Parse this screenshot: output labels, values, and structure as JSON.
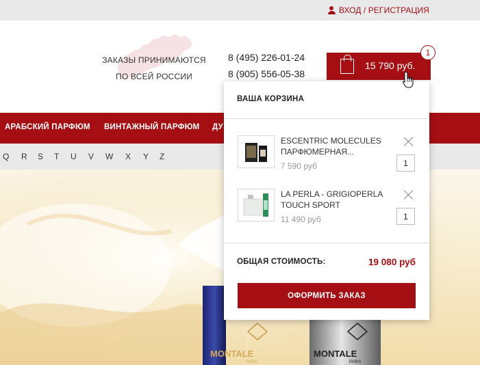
{
  "topbar": {
    "login_label": "ВХОД / РЕГИСТРАЦИЯ"
  },
  "header": {
    "orders_line1": "ЗАКАЗЫ ПРИНИМАЮТСЯ",
    "orders_line2": "ПО ВСЕЙ РОССИИ",
    "phone1": "8 (495) 226-01-24",
    "phone2": "8 (905) 556-05-38"
  },
  "cart": {
    "total": "15 790 руб.",
    "count": "1"
  },
  "nav": {
    "items": [
      "АРАБСКИЙ ПАРФЮМ",
      "ВИНТАЖНЫЙ ПАРФЮМ",
      "ДУ"
    ]
  },
  "alphabet": [
    "Q",
    "R",
    "S",
    "T",
    "U",
    "V",
    "W",
    "X",
    "Y",
    "Z"
  ],
  "dropdown": {
    "title": "ВАША КОРЗИНА",
    "items": [
      {
        "name": "ESCENTRIC MOLECULES ПАРФЮМЕРНАЯ...",
        "price": "7 590 руб",
        "qty": "1"
      },
      {
        "name": "LA PERLA - GRIGIOPERLA TOUCH SPORT",
        "price": "11 490 руб",
        "qty": "1"
      }
    ],
    "total_label": "ОБЩАЯ СТОИМОСТЬ:",
    "total_value": "19 080 руб",
    "checkout_label": "ОФОРМИТЬ ЗАКАЗ"
  },
  "hero": {
    "brand1": "MONTALE",
    "brand1_sub": "PARIS",
    "brand2": "MONTALE",
    "brand2_sub": "PARIS"
  },
  "colors": {
    "accent": "#a50f13",
    "bar_bg": "#e9e9e9"
  }
}
